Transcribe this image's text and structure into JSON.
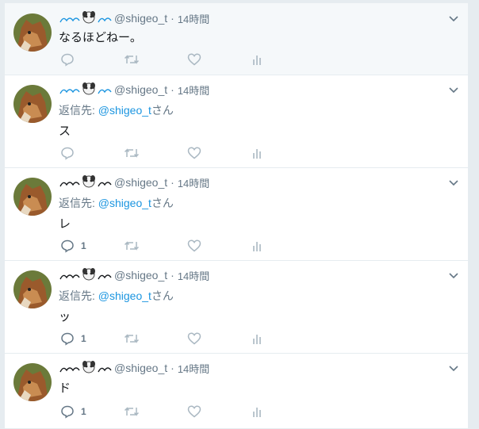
{
  "timeline": {
    "tweets": [
      {
        "handle": "@shigeo_t",
        "separator": "·",
        "time": "14時間",
        "reply_prefix": "",
        "reply_to": "",
        "reply_suffix": "",
        "text": "なるほどねー。",
        "reply_count": "",
        "highlighted": true
      },
      {
        "handle": "@shigeo_t",
        "separator": "·",
        "time": "14時間",
        "reply_prefix": "返信先: ",
        "reply_to": "@shigeo_t",
        "reply_suffix": "さん",
        "text": "ス",
        "reply_count": ""
      },
      {
        "handle": "@shigeo_t",
        "separator": "·",
        "time": "14時間",
        "reply_prefix": "返信先: ",
        "reply_to": "@shigeo_t",
        "reply_suffix": "さん",
        "text": "レ",
        "reply_count": "1"
      },
      {
        "handle": "@shigeo_t",
        "separator": "·",
        "time": "14時間",
        "reply_prefix": "返信先: ",
        "reply_to": "@shigeo_t",
        "reply_suffix": "さん",
        "text": "ッ",
        "reply_count": "1"
      },
      {
        "handle": "@shigeo_t",
        "separator": "·",
        "time": "14時間",
        "reply_prefix": "",
        "reply_to": "",
        "reply_suffix": "",
        "text": "ド",
        "reply_count": "1"
      }
    ]
  },
  "colors": {
    "background": "#e6ecf0",
    "text": "#14171a",
    "secondary_text": "#657786",
    "link": "#1b95e0",
    "icon": "#aab8c2"
  },
  "icons": {
    "avatar": "shiba-dog-avatar",
    "display_name": "swash-and-dog-emoji-name",
    "caret": "chevron-down-icon",
    "reply": "reply-bubble-icon",
    "retweet": "retweet-icon",
    "like": "heart-icon",
    "analytics": "analytics-bars-icon"
  }
}
